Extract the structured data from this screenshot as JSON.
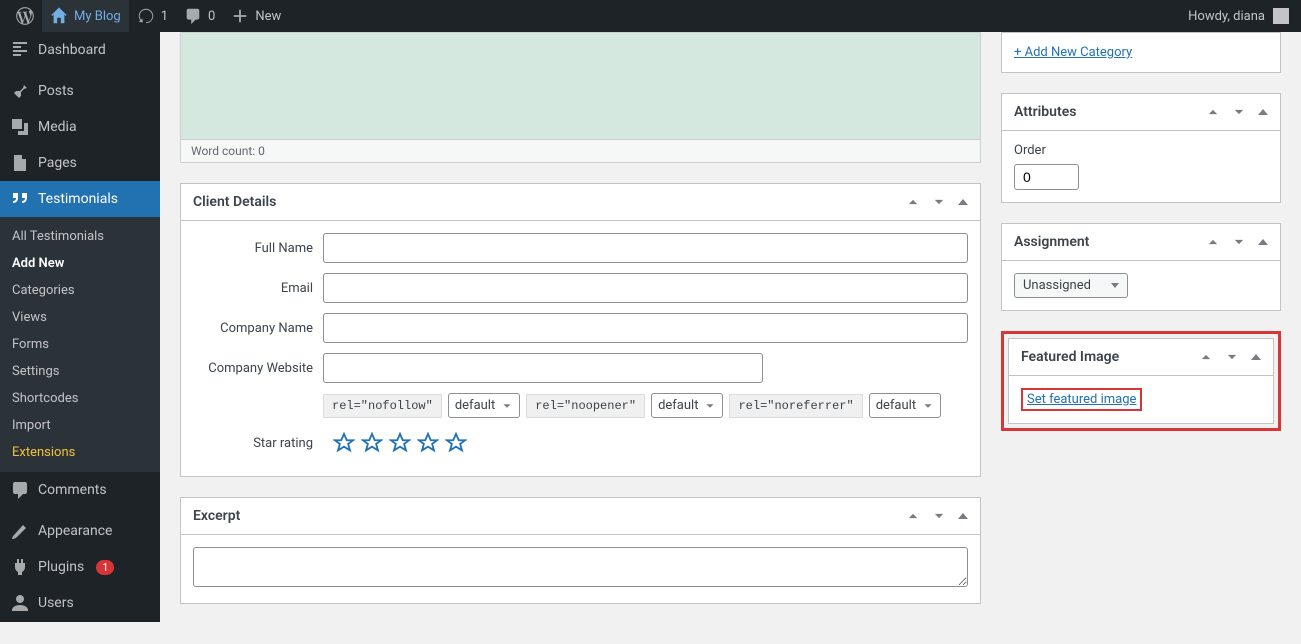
{
  "topbar": {
    "site_name": "My Blog",
    "updates_count": "1",
    "comments_count": "0",
    "new_label": "New",
    "greeting": "Howdy, diana"
  },
  "sidebar": {
    "dashboard": "Dashboard",
    "posts": "Posts",
    "media": "Media",
    "pages": "Pages",
    "testimonials": "Testimonials",
    "sub_all": "All Testimonials",
    "sub_addnew": "Add New",
    "sub_categories": "Categories",
    "sub_views": "Views",
    "sub_forms": "Forms",
    "sub_settings": "Settings",
    "sub_shortcodes": "Shortcodes",
    "sub_import": "Import",
    "sub_extensions": "Extensions",
    "comments": "Comments",
    "appearance": "Appearance",
    "plugins": "Plugins",
    "plugins_badge": "1",
    "users": "Users"
  },
  "editor": {
    "word_count": "Word count: 0"
  },
  "client": {
    "title": "Client Details",
    "full_name_label": "Full Name",
    "email_label": "Email",
    "company_name_label": "Company Name",
    "company_website_label": "Company Website",
    "star_rating_label": "Star rating",
    "rel_nofollow": "rel=\"nofollow\"",
    "rel_noopener": "rel=\"noopener\"",
    "rel_noreferrer": "rel=\"noreferrer\"",
    "default_opt": "default"
  },
  "excerpt": {
    "title": "Excerpt"
  },
  "categories": {
    "add_new": "+ Add New Category"
  },
  "attributes": {
    "title": "Attributes",
    "order_label": "Order",
    "order_value": "0"
  },
  "assignment": {
    "title": "Assignment",
    "value": "Unassigned"
  },
  "featured": {
    "title": "Featured Image",
    "link": "Set featured image"
  }
}
